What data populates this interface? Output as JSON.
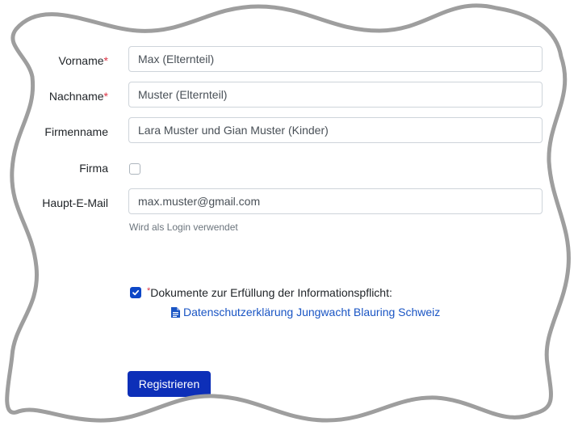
{
  "form": {
    "vorname": {
      "label": "Vorname",
      "required_mark": "*",
      "value": "Max (Elternteil)"
    },
    "nachname": {
      "label": "Nachname",
      "required_mark": "*",
      "value": "Muster (Elternteil)"
    },
    "firmenname": {
      "label": "Firmenname",
      "value": "Lara Muster und Gian Muster (Kinder)"
    },
    "firma": {
      "label": "Firma",
      "checked": false
    },
    "email": {
      "label": "Haupt-E-Mail",
      "value": "max.muster@gmail.com",
      "help": "Wird als Login verwendet"
    },
    "documents": {
      "required_mark": "*",
      "label": "Dokumente zur Erfüllung der Informationspflicht:",
      "checked": true,
      "link_text": "Datenschutzerklärung Jungwacht Blauring Schweiz",
      "link_icon": "file-icon"
    },
    "submit_label": "Registrieren"
  },
  "colors": {
    "required": "#dc3545",
    "primary_button": "#0d2fb8",
    "checkbox_checked": "#0d47c7",
    "link": "#1a55c4"
  }
}
